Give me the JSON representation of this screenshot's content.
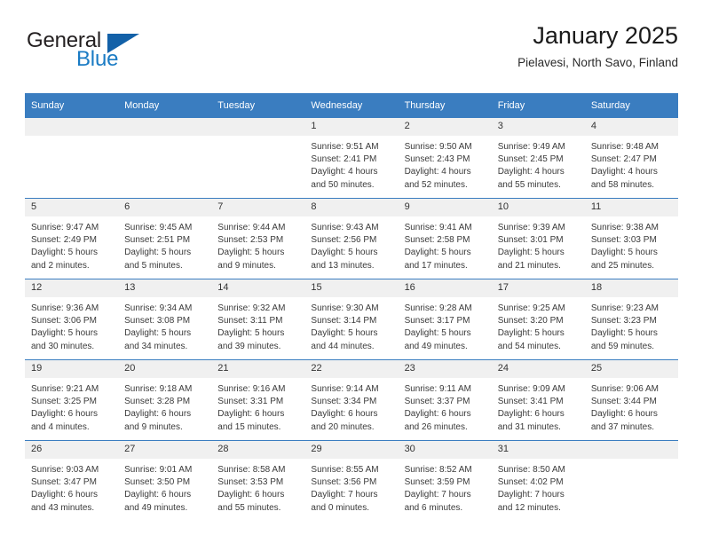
{
  "brand": {
    "name_line1": "General",
    "name_line2": "Blue",
    "triangle_icon": "triangle-logo-icon",
    "color_dark": "#231f20",
    "color_blue": "#1a7bc4",
    "color_triangle": "#1361a8"
  },
  "header": {
    "title": "January 2025",
    "subtitle": "Pielavesi, North Savo, Finland"
  },
  "theme": {
    "header_bar": "#3a7dc0",
    "daynum_band": "#f0f0f0",
    "text": "#3a3a3a"
  },
  "calendar": {
    "weekday_headers": [
      "Sunday",
      "Monday",
      "Tuesday",
      "Wednesday",
      "Thursday",
      "Friday",
      "Saturday"
    ],
    "weeks": [
      [
        {
          "day": "",
          "sunrise": "",
          "sunset": "",
          "daylight_line1": "",
          "daylight_line2": ""
        },
        {
          "day": "",
          "sunrise": "",
          "sunset": "",
          "daylight_line1": "",
          "daylight_line2": ""
        },
        {
          "day": "",
          "sunrise": "",
          "sunset": "",
          "daylight_line1": "",
          "daylight_line2": ""
        },
        {
          "day": "1",
          "sunrise": "Sunrise: 9:51 AM",
          "sunset": "Sunset: 2:41 PM",
          "daylight_line1": "Daylight: 4 hours",
          "daylight_line2": "and 50 minutes."
        },
        {
          "day": "2",
          "sunrise": "Sunrise: 9:50 AM",
          "sunset": "Sunset: 2:43 PM",
          "daylight_line1": "Daylight: 4 hours",
          "daylight_line2": "and 52 minutes."
        },
        {
          "day": "3",
          "sunrise": "Sunrise: 9:49 AM",
          "sunset": "Sunset: 2:45 PM",
          "daylight_line1": "Daylight: 4 hours",
          "daylight_line2": "and 55 minutes."
        },
        {
          "day": "4",
          "sunrise": "Sunrise: 9:48 AM",
          "sunset": "Sunset: 2:47 PM",
          "daylight_line1": "Daylight: 4 hours",
          "daylight_line2": "and 58 minutes."
        }
      ],
      [
        {
          "day": "5",
          "sunrise": "Sunrise: 9:47 AM",
          "sunset": "Sunset: 2:49 PM",
          "daylight_line1": "Daylight: 5 hours",
          "daylight_line2": "and 2 minutes."
        },
        {
          "day": "6",
          "sunrise": "Sunrise: 9:45 AM",
          "sunset": "Sunset: 2:51 PM",
          "daylight_line1": "Daylight: 5 hours",
          "daylight_line2": "and 5 minutes."
        },
        {
          "day": "7",
          "sunrise": "Sunrise: 9:44 AM",
          "sunset": "Sunset: 2:53 PM",
          "daylight_line1": "Daylight: 5 hours",
          "daylight_line2": "and 9 minutes."
        },
        {
          "day": "8",
          "sunrise": "Sunrise: 9:43 AM",
          "sunset": "Sunset: 2:56 PM",
          "daylight_line1": "Daylight: 5 hours",
          "daylight_line2": "and 13 minutes."
        },
        {
          "day": "9",
          "sunrise": "Sunrise: 9:41 AM",
          "sunset": "Sunset: 2:58 PM",
          "daylight_line1": "Daylight: 5 hours",
          "daylight_line2": "and 17 minutes."
        },
        {
          "day": "10",
          "sunrise": "Sunrise: 9:39 AM",
          "sunset": "Sunset: 3:01 PM",
          "daylight_line1": "Daylight: 5 hours",
          "daylight_line2": "and 21 minutes."
        },
        {
          "day": "11",
          "sunrise": "Sunrise: 9:38 AM",
          "sunset": "Sunset: 3:03 PM",
          "daylight_line1": "Daylight: 5 hours",
          "daylight_line2": "and 25 minutes."
        }
      ],
      [
        {
          "day": "12",
          "sunrise": "Sunrise: 9:36 AM",
          "sunset": "Sunset: 3:06 PM",
          "daylight_line1": "Daylight: 5 hours",
          "daylight_line2": "and 30 minutes."
        },
        {
          "day": "13",
          "sunrise": "Sunrise: 9:34 AM",
          "sunset": "Sunset: 3:08 PM",
          "daylight_line1": "Daylight: 5 hours",
          "daylight_line2": "and 34 minutes."
        },
        {
          "day": "14",
          "sunrise": "Sunrise: 9:32 AM",
          "sunset": "Sunset: 3:11 PM",
          "daylight_line1": "Daylight: 5 hours",
          "daylight_line2": "and 39 minutes."
        },
        {
          "day": "15",
          "sunrise": "Sunrise: 9:30 AM",
          "sunset": "Sunset: 3:14 PM",
          "daylight_line1": "Daylight: 5 hours",
          "daylight_line2": "and 44 minutes."
        },
        {
          "day": "16",
          "sunrise": "Sunrise: 9:28 AM",
          "sunset": "Sunset: 3:17 PM",
          "daylight_line1": "Daylight: 5 hours",
          "daylight_line2": "and 49 minutes."
        },
        {
          "day": "17",
          "sunrise": "Sunrise: 9:25 AM",
          "sunset": "Sunset: 3:20 PM",
          "daylight_line1": "Daylight: 5 hours",
          "daylight_line2": "and 54 minutes."
        },
        {
          "day": "18",
          "sunrise": "Sunrise: 9:23 AM",
          "sunset": "Sunset: 3:23 PM",
          "daylight_line1": "Daylight: 5 hours",
          "daylight_line2": "and 59 minutes."
        }
      ],
      [
        {
          "day": "19",
          "sunrise": "Sunrise: 9:21 AM",
          "sunset": "Sunset: 3:25 PM",
          "daylight_line1": "Daylight: 6 hours",
          "daylight_line2": "and 4 minutes."
        },
        {
          "day": "20",
          "sunrise": "Sunrise: 9:18 AM",
          "sunset": "Sunset: 3:28 PM",
          "daylight_line1": "Daylight: 6 hours",
          "daylight_line2": "and 9 minutes."
        },
        {
          "day": "21",
          "sunrise": "Sunrise: 9:16 AM",
          "sunset": "Sunset: 3:31 PM",
          "daylight_line1": "Daylight: 6 hours",
          "daylight_line2": "and 15 minutes."
        },
        {
          "day": "22",
          "sunrise": "Sunrise: 9:14 AM",
          "sunset": "Sunset: 3:34 PM",
          "daylight_line1": "Daylight: 6 hours",
          "daylight_line2": "and 20 minutes."
        },
        {
          "day": "23",
          "sunrise": "Sunrise: 9:11 AM",
          "sunset": "Sunset: 3:37 PM",
          "daylight_line1": "Daylight: 6 hours",
          "daylight_line2": "and 26 minutes."
        },
        {
          "day": "24",
          "sunrise": "Sunrise: 9:09 AM",
          "sunset": "Sunset: 3:41 PM",
          "daylight_line1": "Daylight: 6 hours",
          "daylight_line2": "and 31 minutes."
        },
        {
          "day": "25",
          "sunrise": "Sunrise: 9:06 AM",
          "sunset": "Sunset: 3:44 PM",
          "daylight_line1": "Daylight: 6 hours",
          "daylight_line2": "and 37 minutes."
        }
      ],
      [
        {
          "day": "26",
          "sunrise": "Sunrise: 9:03 AM",
          "sunset": "Sunset: 3:47 PM",
          "daylight_line1": "Daylight: 6 hours",
          "daylight_line2": "and 43 minutes."
        },
        {
          "day": "27",
          "sunrise": "Sunrise: 9:01 AM",
          "sunset": "Sunset: 3:50 PM",
          "daylight_line1": "Daylight: 6 hours",
          "daylight_line2": "and 49 minutes."
        },
        {
          "day": "28",
          "sunrise": "Sunrise: 8:58 AM",
          "sunset": "Sunset: 3:53 PM",
          "daylight_line1": "Daylight: 6 hours",
          "daylight_line2": "and 55 minutes."
        },
        {
          "day": "29",
          "sunrise": "Sunrise: 8:55 AM",
          "sunset": "Sunset: 3:56 PM",
          "daylight_line1": "Daylight: 7 hours",
          "daylight_line2": "and 0 minutes."
        },
        {
          "day": "30",
          "sunrise": "Sunrise: 8:52 AM",
          "sunset": "Sunset: 3:59 PM",
          "daylight_line1": "Daylight: 7 hours",
          "daylight_line2": "and 6 minutes."
        },
        {
          "day": "31",
          "sunrise": "Sunrise: 8:50 AM",
          "sunset": "Sunset: 4:02 PM",
          "daylight_line1": "Daylight: 7 hours",
          "daylight_line2": "and 12 minutes."
        },
        {
          "day": "",
          "sunrise": "",
          "sunset": "",
          "daylight_line1": "",
          "daylight_line2": ""
        }
      ]
    ]
  }
}
